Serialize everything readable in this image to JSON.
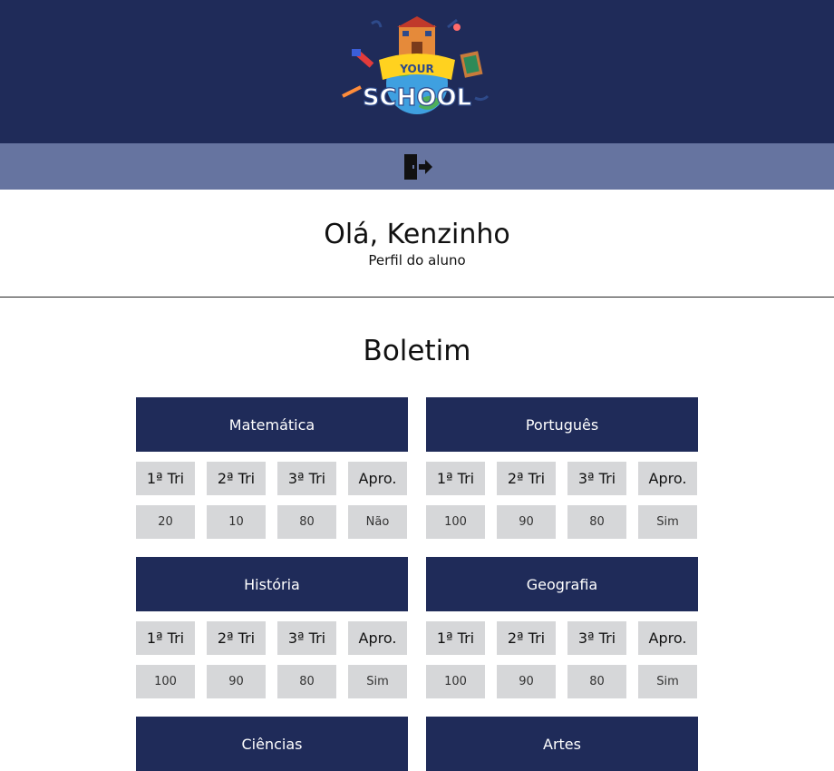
{
  "header": {
    "logo": {
      "text_top": "YOUR",
      "text_bottom": "SCHOOL"
    },
    "logout": {
      "icon": "logout-door-icon"
    }
  },
  "greeting": {
    "title": "Olá, Kenzinho",
    "subtitle": "Perfil do aluno"
  },
  "report": {
    "title": "Boletim",
    "columns": [
      "1ª Tri",
      "2ª Tri",
      "3ª Tri",
      "Apro."
    ],
    "subjects": [
      {
        "name": "Matemática",
        "values": [
          "20",
          "10",
          "80",
          "Não"
        ]
      },
      {
        "name": "Português",
        "values": [
          "100",
          "90",
          "80",
          "Sim"
        ]
      },
      {
        "name": "História",
        "values": [
          "100",
          "90",
          "80",
          "Sim"
        ]
      },
      {
        "name": "Geografia",
        "values": [
          "100",
          "90",
          "80",
          "Sim"
        ]
      },
      {
        "name": "Ciências",
        "values": []
      },
      {
        "name": "Artes",
        "values": []
      }
    ]
  },
  "colors": {
    "navy": "#1f2b59",
    "subbar": "#6674a0",
    "cell": "#d6d7d9"
  }
}
